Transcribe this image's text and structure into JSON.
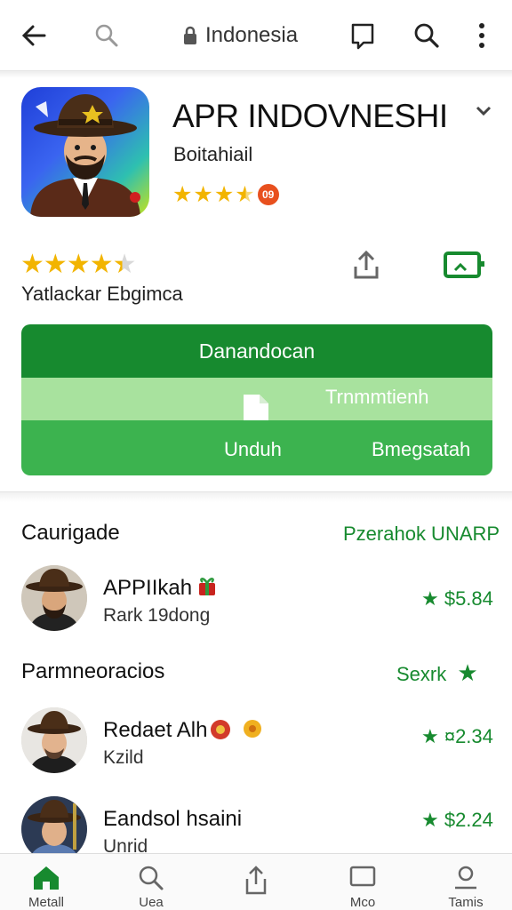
{
  "topbar": {
    "address": "Indonesia"
  },
  "app": {
    "title": "APR INDOVNESHI",
    "subtitle": "Boitahiail",
    "badge": "09",
    "rating_label": "Yatlackar Ebgimca"
  },
  "actions": {
    "primary": "Danandocan",
    "strip_label": "Trnmmtienh",
    "left": "Unduh",
    "right": "Bmegsatah"
  },
  "section1": {
    "title": "Caurigade",
    "link": "Pzerahok UNARP",
    "items": [
      {
        "name": "APPIIkah",
        "sub": "Rark    19dong",
        "price": "★ $5.84"
      }
    ]
  },
  "section2": {
    "title": "Parmneoracios",
    "link": "Sexrk",
    "items": [
      {
        "name": "Redaet Alh",
        "sub": "Kzild",
        "price": "★ ¤2.34"
      },
      {
        "name": "Eandsol hsaini",
        "sub": "Unrid",
        "price": "★ $2.24"
      }
    ]
  },
  "nav": [
    "Metall",
    "Uea",
    "",
    "Mco",
    "Tamis"
  ],
  "colors": {
    "accent": "#178a2f",
    "star": "#f2b400",
    "light_green": "#a8e29e",
    "mid_green": "#3cb34f"
  }
}
